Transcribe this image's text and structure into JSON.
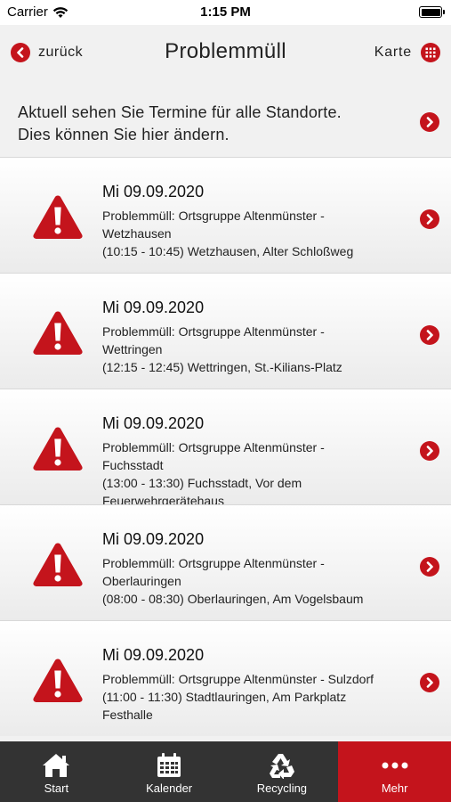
{
  "status_bar": {
    "carrier": "Carrier",
    "time": "1:15 PM"
  },
  "nav": {
    "back_label": "zurück",
    "title": "Problemmüll",
    "map_label": "Karte"
  },
  "info_banner": {
    "line1": "Aktuell sehen Sie Termine für alle Standorte.",
    "line2": "Dies können Sie hier ändern."
  },
  "items": [
    {
      "date": "Mi 09.09.2020",
      "line1": "Problemmüll: Ortsgruppe Altenmünster -",
      "line2": "Wetzhausen",
      "line3": "(10:15 - 10:45) Wetzhausen, Alter Schloßweg",
      "line4": ""
    },
    {
      "date": "Mi 09.09.2020",
      "line1": "Problemmüll: Ortsgruppe Altenmünster -",
      "line2": "Wettringen",
      "line3": "(12:15 - 12:45) Wettringen, St.-Kilians-Platz",
      "line4": ""
    },
    {
      "date": "Mi 09.09.2020",
      "line1": "Problemmüll: Ortsgruppe Altenmünster -",
      "line2": "Fuchsstadt",
      "line3": "(13:00 - 13:30) Fuchsstadt, Vor dem",
      "line4": "Feuerwehrgerätehaus"
    },
    {
      "date": "Mi 09.09.2020",
      "line1": "Problemmüll: Ortsgruppe Altenmünster -",
      "line2": "Oberlauringen",
      "line3": "(08:00 - 08:30) Oberlauringen, Am Vogelsbaum",
      "line4": ""
    },
    {
      "date": "Mi 09.09.2020",
      "line1": "Problemmüll: Ortsgruppe Altenmünster - Sulzdorf",
      "line2": "(11:00 - 11:30) Stadtlauringen, Am Parkplatz",
      "line3": "Festhalle",
      "line4": ""
    }
  ],
  "tabs": [
    {
      "label": "Start",
      "icon": "home-icon",
      "active": false
    },
    {
      "label": "Kalender",
      "icon": "calendar-icon",
      "active": false
    },
    {
      "label": "Recycling",
      "icon": "recycling-icon",
      "active": false
    },
    {
      "label": "Mehr",
      "icon": "more-icon",
      "active": true
    }
  ],
  "colors": {
    "accent": "#c4141c",
    "tab_bar": "#333333",
    "background": "#f1f1f1"
  }
}
